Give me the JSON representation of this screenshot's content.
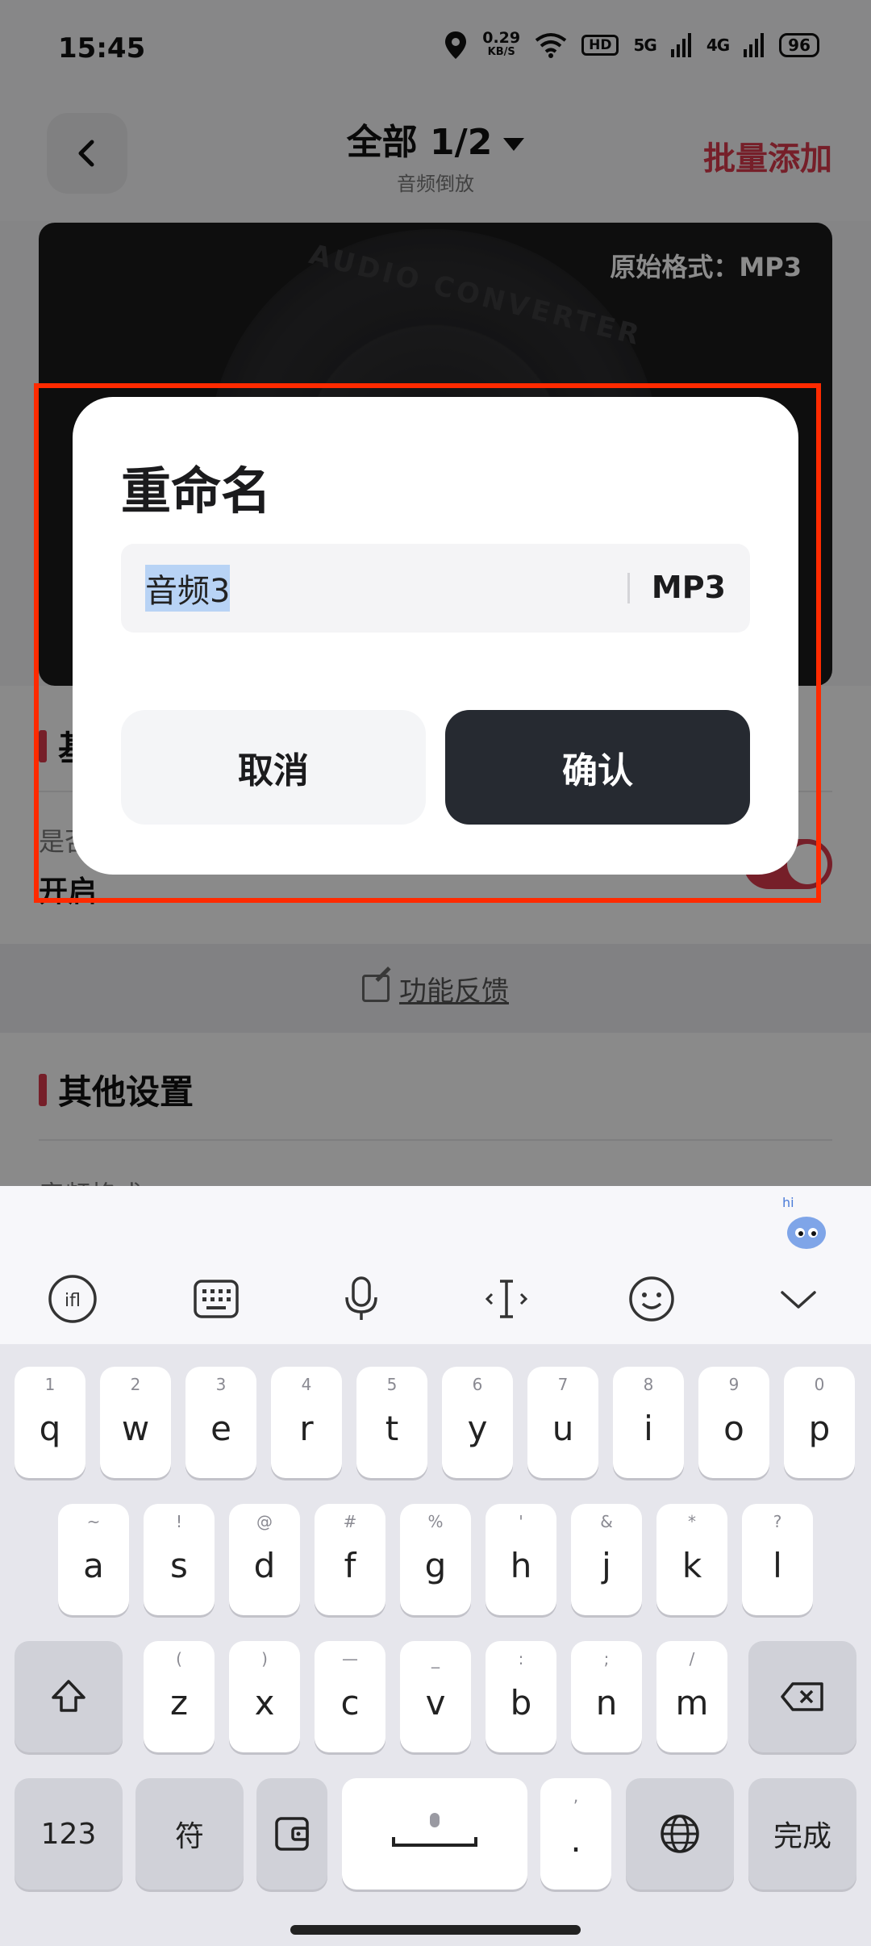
{
  "status_bar": {
    "time": "15:45",
    "net_speed_value": "0.29",
    "net_speed_unit": "KB/S",
    "hd_badge": "HD",
    "signal_5g": "5G",
    "signal_4g": "4G",
    "battery": "96"
  },
  "header": {
    "title": "全部 1/2",
    "subtitle": "音频倒放",
    "batch_add": "批量添加"
  },
  "player": {
    "format_label": "原始格式：MP3",
    "record_text": "AUDIO CONVERTER"
  },
  "basic_section": {
    "title": "基",
    "row_label": "是否",
    "row_value": "开启"
  },
  "feedback": {
    "label": "功能反馈"
  },
  "other_section": {
    "title": "其他设置",
    "row_label": "音频格式"
  },
  "dialog": {
    "title": "重命名",
    "filename_value": "音频3",
    "extension": "MP3",
    "cancel_label": "取消",
    "confirm_label": "确认"
  },
  "keyboard": {
    "toolbar_icons": [
      "voice-input-icon",
      "keyboard-layout-icon",
      "microphone-icon",
      "cursor-icon",
      "emoji-icon",
      "chevron-down-icon"
    ],
    "mascot_badge": "hi",
    "row1": [
      {
        "hint": "1",
        "key": "q"
      },
      {
        "hint": "2",
        "key": "w"
      },
      {
        "hint": "3",
        "key": "e"
      },
      {
        "hint": "4",
        "key": "r"
      },
      {
        "hint": "5",
        "key": "t"
      },
      {
        "hint": "6",
        "key": "y"
      },
      {
        "hint": "7",
        "key": "u"
      },
      {
        "hint": "8",
        "key": "i"
      },
      {
        "hint": "9",
        "key": "o"
      },
      {
        "hint": "0",
        "key": "p"
      }
    ],
    "row2": [
      {
        "hint": "~",
        "key": "a"
      },
      {
        "hint": "!",
        "key": "s"
      },
      {
        "hint": "@",
        "key": "d"
      },
      {
        "hint": "#",
        "key": "f"
      },
      {
        "hint": "%",
        "key": "g"
      },
      {
        "hint": "'",
        "key": "h"
      },
      {
        "hint": "&",
        "key": "j"
      },
      {
        "hint": "*",
        "key": "k"
      },
      {
        "hint": "?",
        "key": "l"
      }
    ],
    "row3": [
      {
        "hint": "(",
        "key": "z"
      },
      {
        "hint": ")",
        "key": "x"
      },
      {
        "hint": "—",
        "key": "c"
      },
      {
        "hint": "_",
        "key": "v"
      },
      {
        "hint": ":",
        "key": "b"
      },
      {
        "hint": ";",
        "key": "n"
      },
      {
        "hint": "/",
        "key": "m"
      }
    ],
    "numbers_key": "123",
    "symbols_key": "符",
    "period_key": ".",
    "period_hint": ",",
    "done_key": "完成"
  }
}
